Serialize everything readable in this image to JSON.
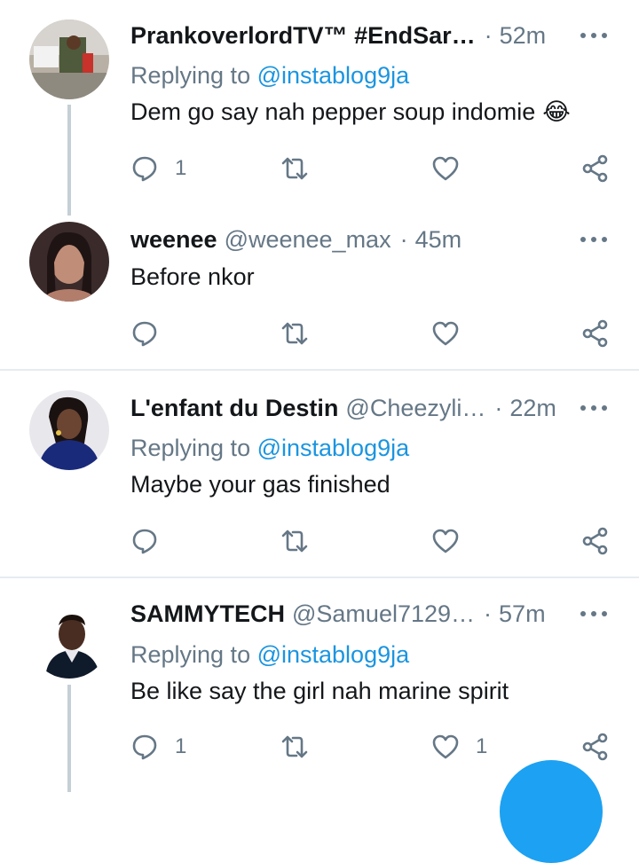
{
  "colors": {
    "accent": "#1da1f2",
    "mention": "#1b95e0",
    "muted": "#657786",
    "divider": "#e6ecf0"
  },
  "tweets": [
    {
      "name": "PrankoverlordTV™ #EndSar…",
      "handle": "",
      "time": "52m",
      "replying_prefix": "Replying to ",
      "replying_to": "@instablog9ja",
      "text": "Dem go say nah pepper soup indomie",
      "emoji": "😂",
      "reply_count": "1",
      "retweet_count": "",
      "like_count": ""
    },
    {
      "name": "weenee",
      "handle": "@weenee_max",
      "time": "45m",
      "text": "Before nkor",
      "reply_count": "",
      "retweet_count": "",
      "like_count": ""
    },
    {
      "name": "L'enfant du Destin",
      "handle": "@Cheezyli…",
      "time": "22m",
      "replying_prefix": "Replying to ",
      "replying_to": "@instablog9ja",
      "text": "Maybe your gas finished",
      "reply_count": "",
      "retweet_count": "",
      "like_count": ""
    },
    {
      "name": "SAMMYTECH",
      "handle": "@Samuel7129…",
      "time": "57m",
      "replying_prefix": "Replying to ",
      "replying_to": "@instablog9ja",
      "text": "Be like say the girl nah marine spirit",
      "reply_count": "1",
      "retweet_count": "",
      "like_count": "1"
    }
  ],
  "icons": [
    "reply-icon",
    "retweet-icon",
    "like-icon",
    "share-icon",
    "more-icon",
    "compose-button"
  ]
}
